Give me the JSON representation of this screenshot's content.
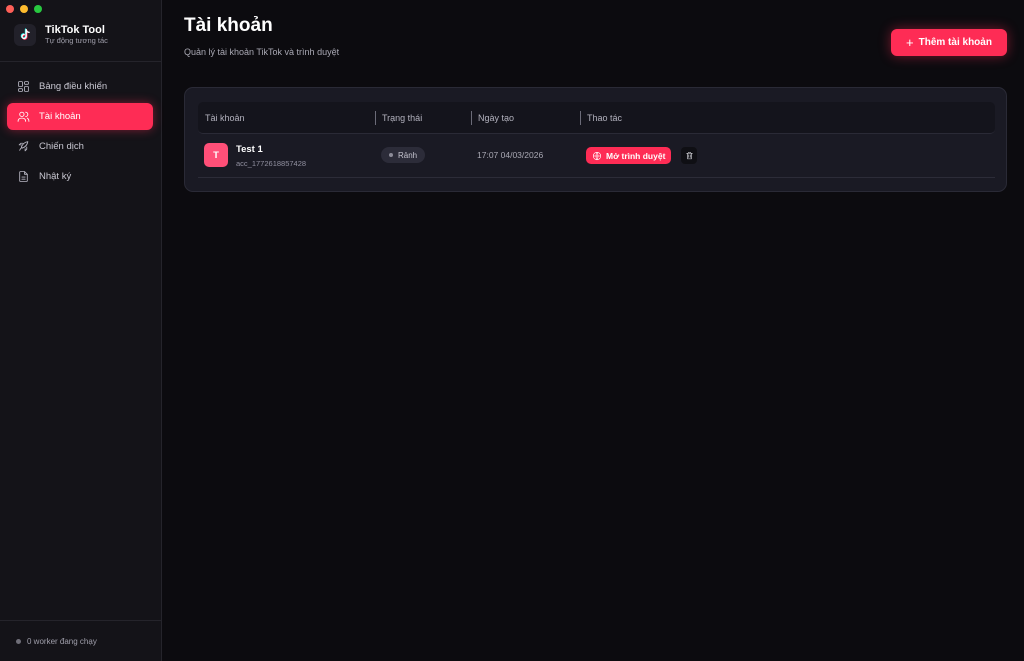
{
  "app": {
    "name": "TikTok Tool",
    "tagline": "Tự động tương tác"
  },
  "sidebar": {
    "items": [
      {
        "label": "Bảng điều khiển",
        "icon": "dashboard-icon",
        "active": false
      },
      {
        "label": "Tài khoản",
        "icon": "users-icon",
        "active": true
      },
      {
        "label": "Chiến dịch",
        "icon": "rocket-icon",
        "active": false
      },
      {
        "label": "Nhật ký",
        "icon": "document-icon",
        "active": false
      }
    ],
    "footer_status": "0 worker đang chạy"
  },
  "page": {
    "title": "Tài khoản",
    "subtitle": "Quản lý tài khoản TikTok và trình duyệt",
    "add_button_label": "Thêm tài khoản"
  },
  "table": {
    "columns": [
      "Tài khoản",
      "Trạng thái",
      "Ngày tạo",
      "Thao tác"
    ],
    "rows": [
      {
        "avatar_letter": "T",
        "name": "Test 1",
        "id": "acc_1772618857428",
        "status": "Rảnh",
        "created": "17:07 04/03/2026",
        "action_label": "Mở trình duyệt"
      }
    ]
  },
  "colors": {
    "accent": "#fe2c55",
    "background": "#0c0b0f",
    "sidebar": "#141318",
    "card": "#1a1a24"
  }
}
